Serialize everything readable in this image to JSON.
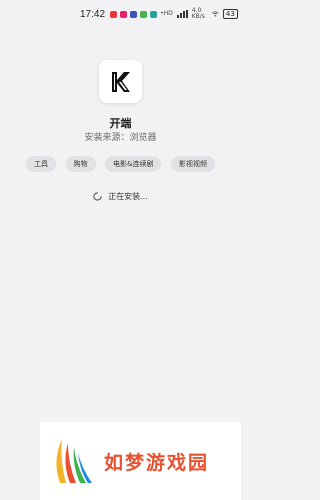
{
  "status_bar": {
    "time": "17:42",
    "signal_text": "HD",
    "speed_text": "4.0 KB/s",
    "battery": "43",
    "notification_colors": [
      "#e53935",
      "#e91e63",
      "#3f51b5",
      "#4caf50",
      "#26a69a"
    ]
  },
  "app": {
    "name": "开端",
    "source": "安装来源：浏览器",
    "icon_letter": "K"
  },
  "tags": [
    "工具",
    "购物",
    "电影&连续剧",
    "影视视频"
  ],
  "status": {
    "installing_text": "正在安装..."
  },
  "banner": {
    "text": "如梦游戏园",
    "logo_colors": [
      "#f2b32b",
      "#e8502f",
      "#3fb34f",
      "#1e88e5"
    ]
  }
}
